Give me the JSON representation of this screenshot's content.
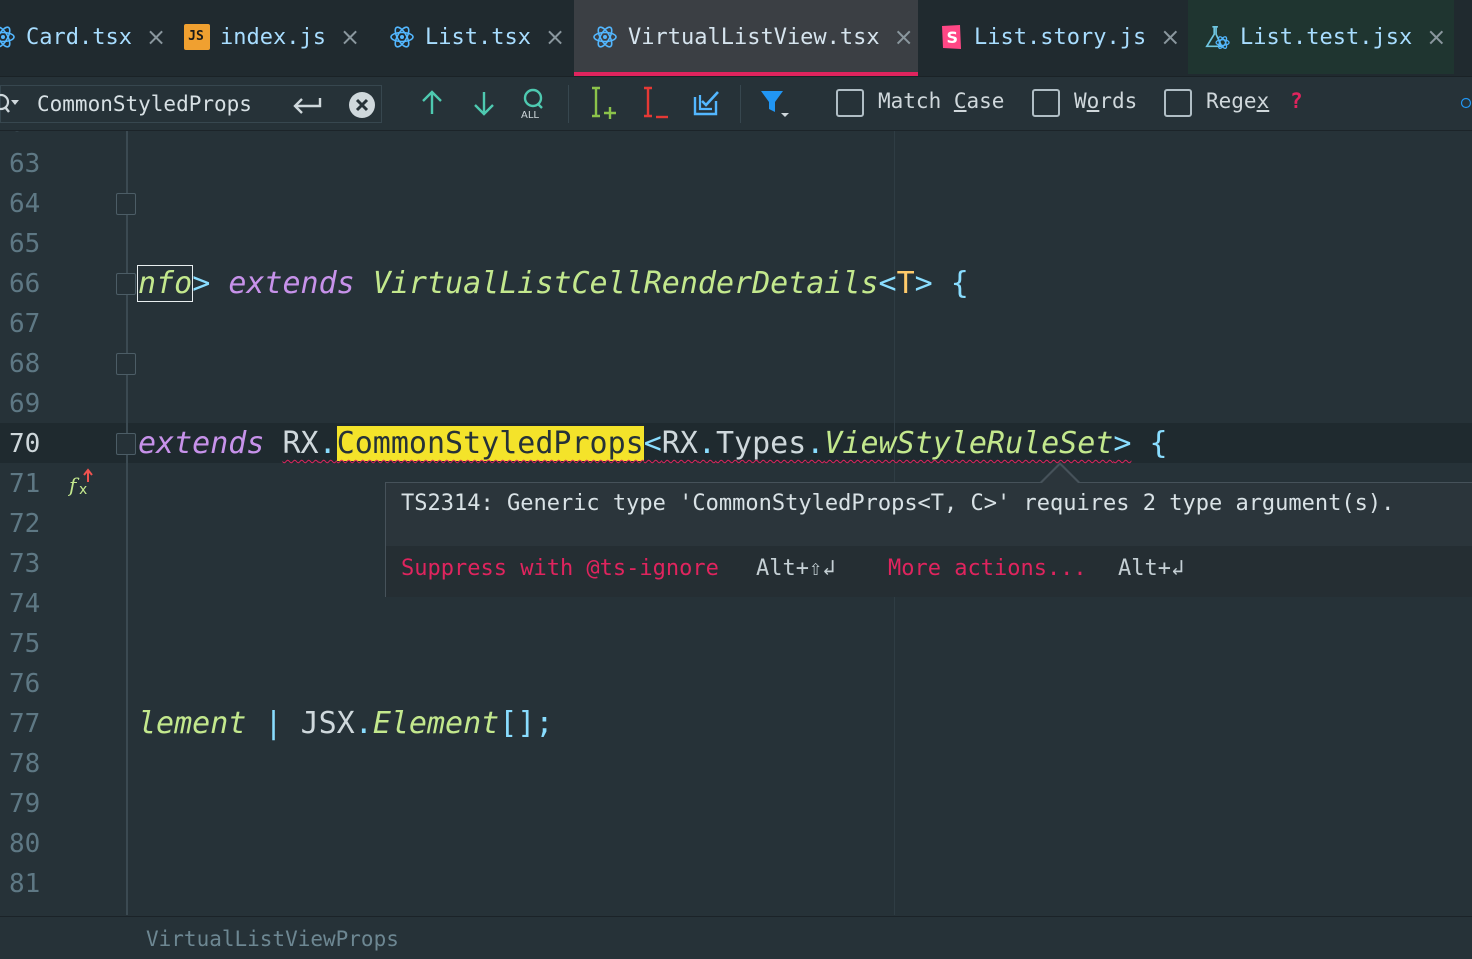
{
  "tabs": [
    {
      "label": "Card.tsx",
      "icon": "react-icon",
      "close": "×"
    },
    {
      "label": "index.js",
      "icon": "js-file-icon",
      "icon_text": "JS",
      "close": "×"
    },
    {
      "label": "List.tsx",
      "icon": "react-icon",
      "close": "×"
    },
    {
      "label": "VirtualListView.tsx",
      "icon": "react-icon",
      "close": "×",
      "active": true
    },
    {
      "label": "List.story.js",
      "icon": "storybook-icon",
      "close": "×"
    },
    {
      "label": "List.test.jsx",
      "icon": "test-flask-icon",
      "close": "×"
    }
  ],
  "find": {
    "query": "CommonStyledProps",
    "options": {
      "match_case": {
        "text_before": "Match ",
        "underlined": "C",
        "text_after": "ase",
        "checked": false
      },
      "words": {
        "text_before": "W",
        "underlined": "o",
        "text_after": "rds",
        "checked": false
      },
      "regex": {
        "text_before": "Rege",
        "underlined": "x",
        "text_after": "",
        "checked": false
      },
      "help": "?"
    },
    "icons": [
      "search-history-icon",
      "enter-icon",
      "clear-search-icon",
      "previous-occurrence-icon",
      "next-occurrence-icon",
      "select-all-occurrences-icon",
      "add-occurrence-icon",
      "remove-occurrence-icon",
      "select-all-icon",
      "filter-icon"
    ]
  },
  "editor": {
    "line_numbers": [
      "63",
      "64",
      "65",
      "66",
      "67",
      "68",
      "69",
      "70",
      "71",
      "72",
      "73",
      "74",
      "75",
      "76",
      "77",
      "78",
      "79",
      "80",
      "81"
    ],
    "current_line": "70",
    "line66": {
      "a": "nfo",
      "b": ">",
      "c": "extends",
      "d": "VirtualListCellRenderDetails",
      "e": "<",
      "f": "T",
      "g": ">",
      "h": "{"
    },
    "line70": {
      "a": "extends",
      "b": "RX",
      "c": ".",
      "d": "CommonStyledProps",
      "e": "<",
      "f": "RX",
      "g": ".",
      "h": "Types",
      "i": ".",
      "j": "ViewStyleRuleSet",
      "k": ">",
      "l": "{"
    },
    "line77": {
      "a": "lement",
      "b": "|",
      "c": "JSX",
      "d": ".",
      "e": "Element",
      "f": "[];"
    }
  },
  "tooltip": {
    "message": "TS2314: Generic type 'CommonStyledProps<T, C>' requires 2 type argument(s).",
    "action1": "Suppress with @ts-ignore",
    "action1_key": "Alt+⇧↲",
    "action2": "More actions...",
    "action2_key": "Alt+↲"
  },
  "breadcrumb": "VirtualListViewProps",
  "colors": {
    "accent": "#e0245e",
    "highlight": "#f4e32a",
    "background": "#263238"
  }
}
